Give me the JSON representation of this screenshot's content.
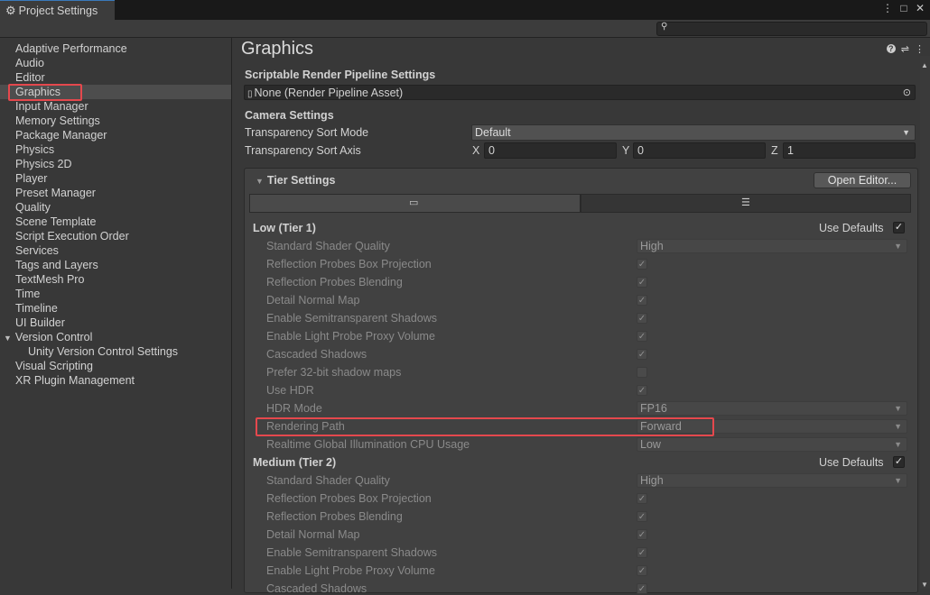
{
  "window": {
    "tab_title": "Project Settings"
  },
  "window_buttons": {
    "more": "⋮",
    "maximize": "□",
    "close": "✕"
  },
  "sidebar": {
    "items": [
      "Adaptive Performance",
      "Audio",
      "Editor",
      "Graphics",
      "Input Manager",
      "Memory Settings",
      "Package Manager",
      "Physics",
      "Physics 2D",
      "Player",
      "Preset Manager",
      "Quality",
      "Scene Template",
      "Script Execution Order",
      "Services",
      "Tags and Layers",
      "TextMesh Pro",
      "Time",
      "Timeline",
      "UI Builder",
      "Version Control",
      "Unity Version Control Settings",
      "Visual Scripting",
      "XR Plugin Management"
    ],
    "selected": "Graphics"
  },
  "page": {
    "title": "Graphics"
  },
  "srp": {
    "heading": "Scriptable Render Pipeline Settings",
    "value": "None (Render Pipeline Asset)"
  },
  "camera": {
    "heading": "Camera Settings",
    "sort_mode_label": "Transparency Sort Mode",
    "sort_mode_value": "Default",
    "sort_axis_label": "Transparency Sort Axis",
    "x_label": "X",
    "x_value": "0",
    "y_label": "Y",
    "y_value": "0",
    "z_label": "Z",
    "z_value": "1"
  },
  "tier_settings": {
    "heading": "Tier Settings",
    "open_editor": "Open Editor...",
    "use_defaults": "Use Defaults",
    "tiers": [
      {
        "name": "Low (Tier 1)",
        "use_defaults": true
      },
      {
        "name": "Medium (Tier 2)",
        "use_defaults": true
      }
    ],
    "low_rows": [
      {
        "label": "Standard Shader Quality",
        "value": "High"
      },
      {
        "label": "Reflection Probes Box Projection",
        "checked": true
      },
      {
        "label": "Reflection Probes Blending",
        "checked": true
      },
      {
        "label": "Detail Normal Map",
        "checked": true
      },
      {
        "label": "Enable Semitransparent Shadows",
        "checked": true
      },
      {
        "label": "Enable Light Probe Proxy Volume",
        "checked": true
      },
      {
        "label": "Cascaded Shadows",
        "checked": true
      },
      {
        "label": "Prefer 32-bit shadow maps",
        "checked": false
      },
      {
        "label": "Use HDR",
        "checked": true
      },
      {
        "label": "HDR Mode",
        "value": "FP16"
      },
      {
        "label": "Rendering Path",
        "value": "Forward"
      },
      {
        "label": "Realtime Global Illumination CPU Usage",
        "value": "Low"
      }
    ],
    "medium_rows": [
      {
        "label": "Standard Shader Quality",
        "value": "High"
      },
      {
        "label": "Reflection Probes Box Projection",
        "checked": true
      },
      {
        "label": "Reflection Probes Blending",
        "checked": true
      },
      {
        "label": "Detail Normal Map",
        "checked": true
      },
      {
        "label": "Enable Semitransparent Shadows",
        "checked": true
      },
      {
        "label": "Enable Light Probe Proxy Volume",
        "checked": true
      },
      {
        "label": "Cascaded Shadows",
        "checked": true
      }
    ]
  },
  "colors": {
    "highlight": "#e5484d",
    "accent": "#3a79bb"
  }
}
